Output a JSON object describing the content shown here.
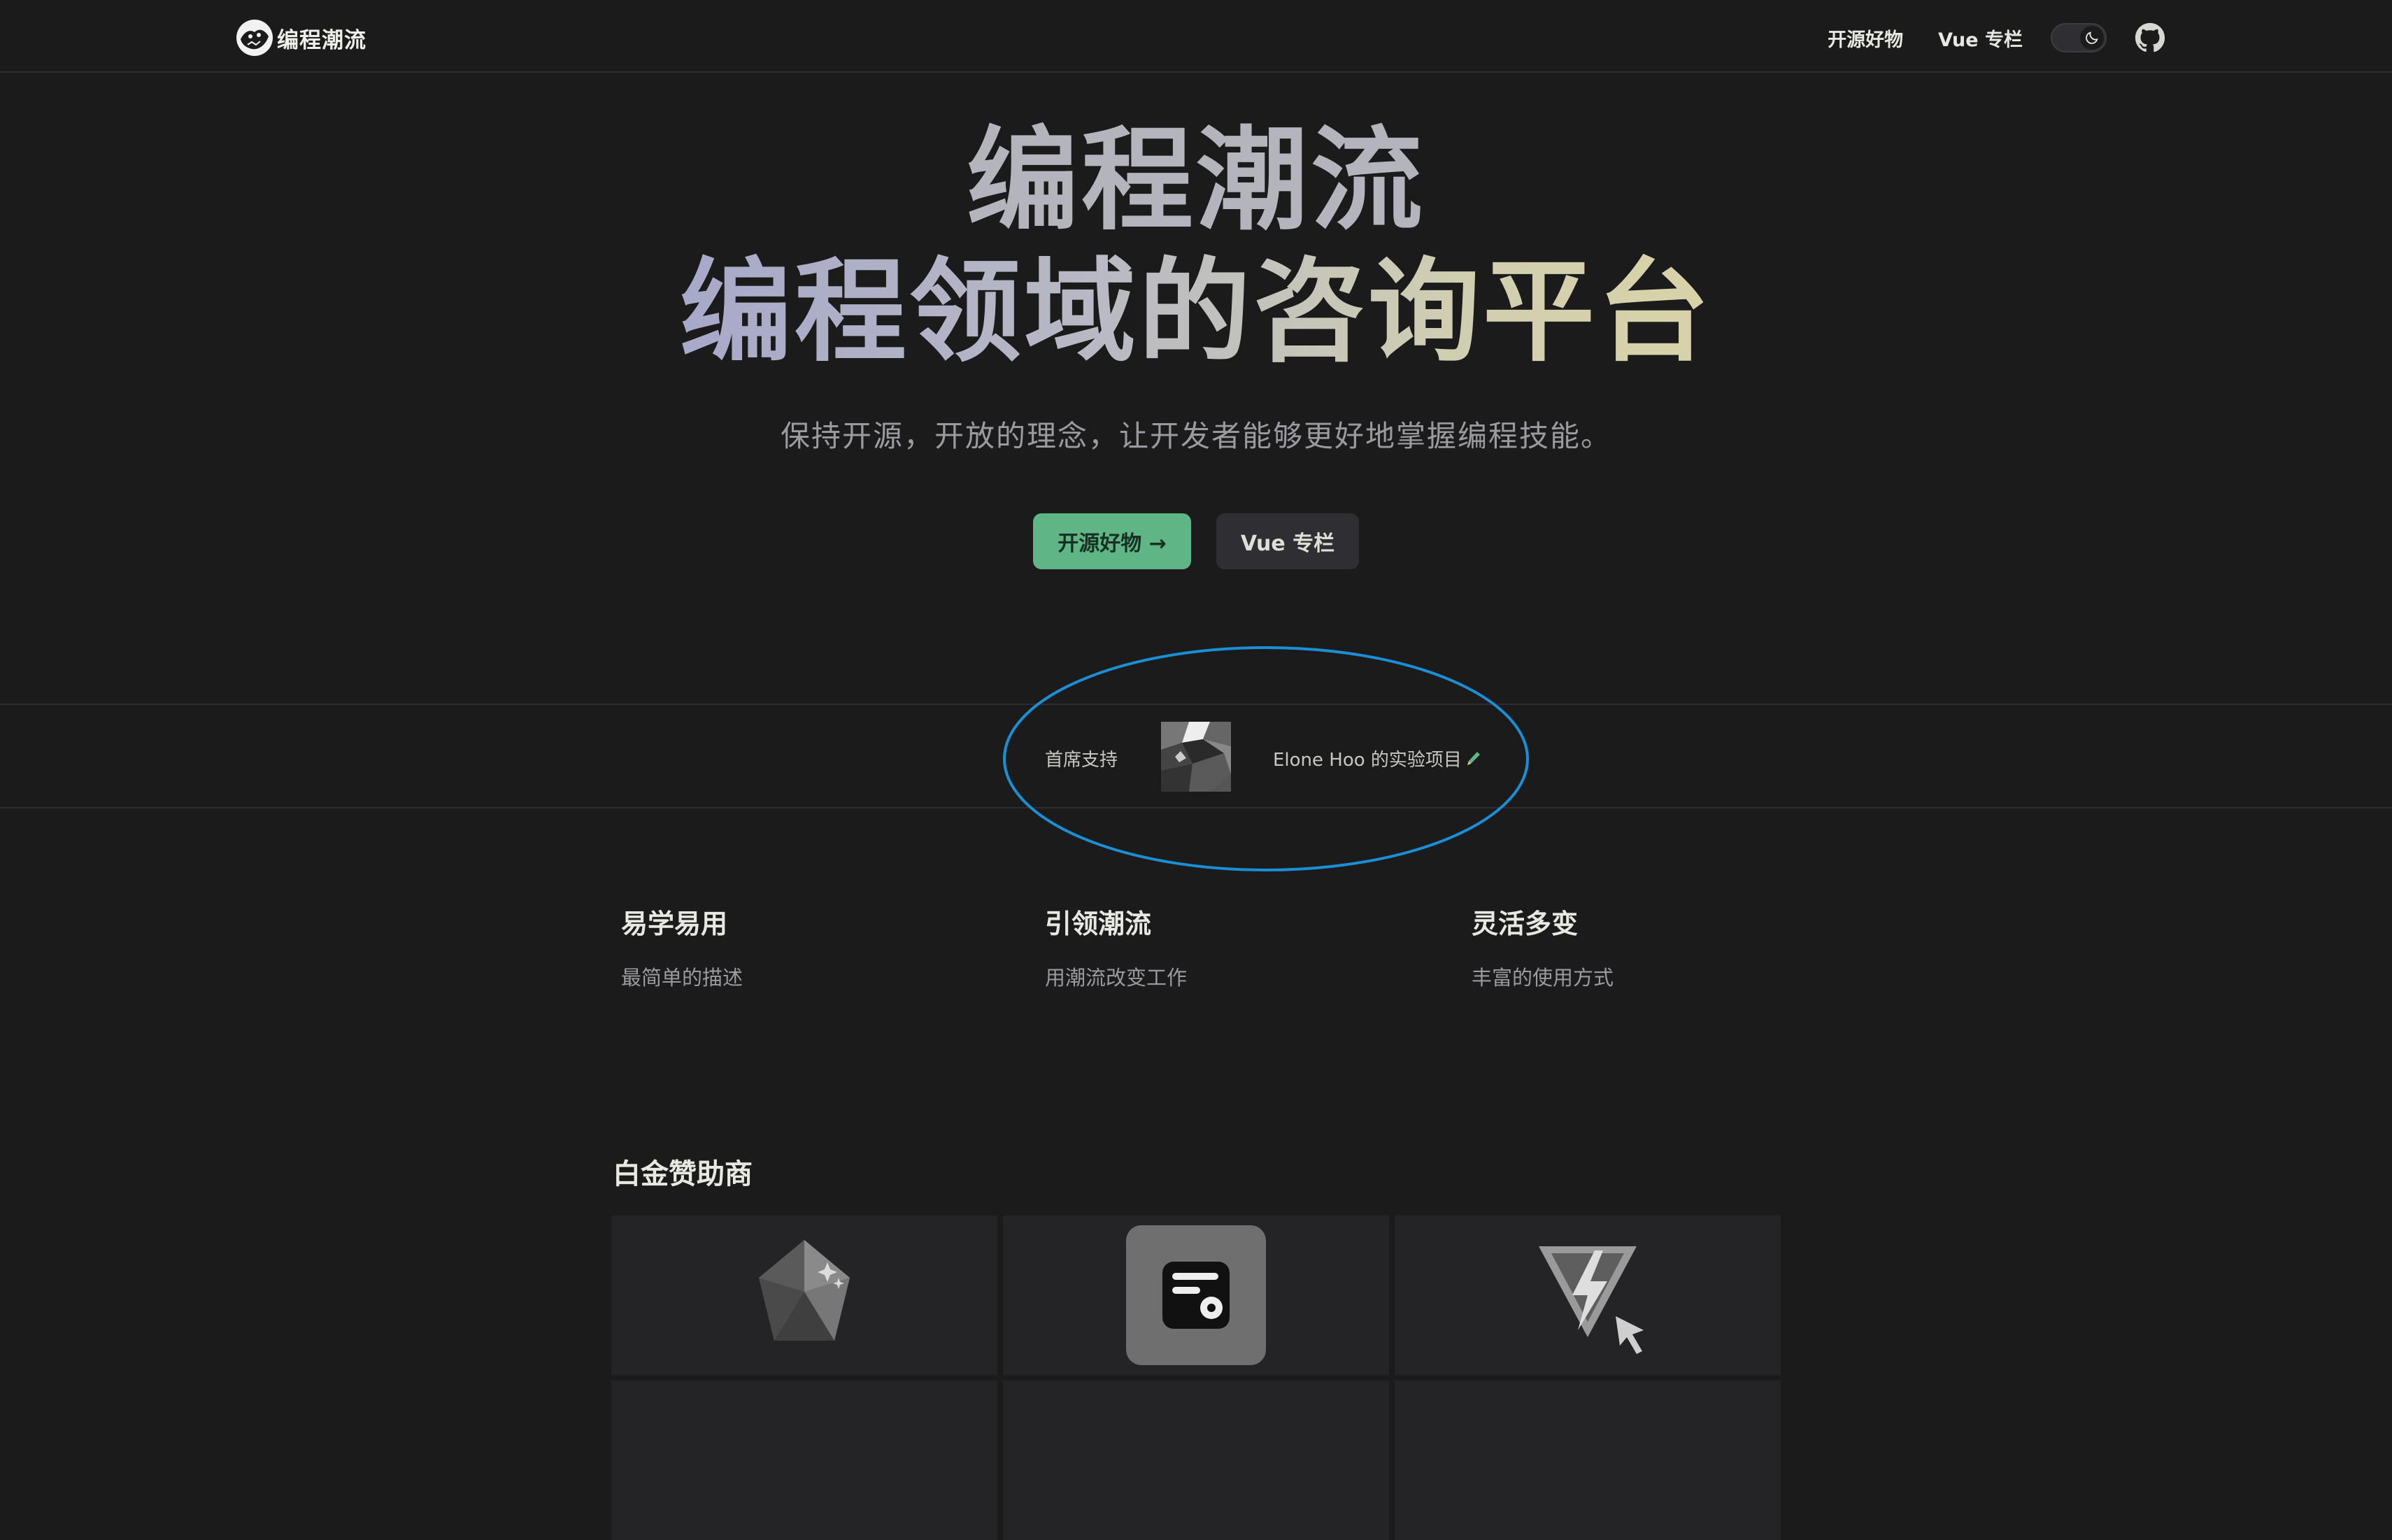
{
  "nav": {
    "brand_title": "编程潮流",
    "links": [
      "开源好物",
      "Vue 专栏"
    ],
    "icons": [
      "site-logo-icon",
      "moon-icon",
      "github-icon"
    ]
  },
  "hero": {
    "line1": "编程潮流",
    "line2": "编程领域的咨询平台",
    "tagline": "保持开源，开放的理念，让开发者能够更好地掌握编程技能。",
    "primary_button": "开源好物 →",
    "secondary_button": "Vue 专栏"
  },
  "sponsor_strip": {
    "label": "首席支持",
    "sponsor_text": "Elone Hoo 的实验项目",
    "icon": "pencil-icon"
  },
  "features": [
    {
      "title": "易学易用",
      "desc": "最简单的描述"
    },
    {
      "title": "引领潮流",
      "desc": "用潮流改变工作"
    },
    {
      "title": "灵活多变",
      "desc": "丰富的使用方式"
    }
  ],
  "platinum": {
    "title": "白金赞助商",
    "logos": [
      "gem-logo-icon",
      "settings-card-icon",
      "vite-cursor-logo-icon"
    ]
  },
  "colors": {
    "background": "#1b1b1b",
    "primary": "#5fb585",
    "highlight": "#1a8fd6"
  }
}
